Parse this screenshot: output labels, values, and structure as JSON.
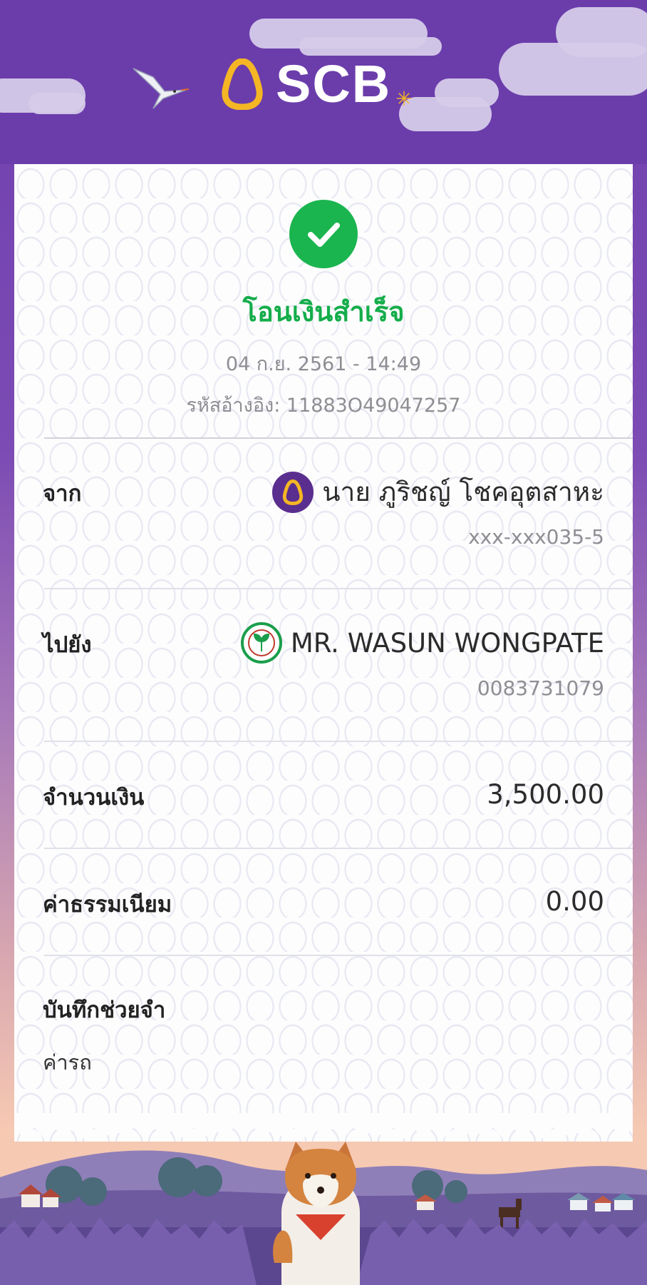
{
  "brand": {
    "name": "SCB",
    "primary_color": "#6b3dab",
    "accent_color": "#f4b624"
  },
  "status": {
    "icon": "check-circle-icon",
    "title": "โอนเงินสำเร็จ",
    "color": "#14ad4a"
  },
  "datetime": "04 ก.ย. 2561 - 14:49",
  "reference": "รหัสอ้างอิง: 11883O49047257",
  "from": {
    "label": "จาก",
    "name": "นาย ภูริชญ์ โชคอุตสาหะ",
    "account": "xxx-xxx035-5",
    "bank_icon": "scb-bank-icon"
  },
  "to": {
    "label": "ไปยัง",
    "name": "MR. WASUN WONGPATE",
    "account": "0083731079",
    "bank_icon": "kbank-bank-icon"
  },
  "amount": {
    "label": "จำนวนเงิน",
    "value": "3,500.00"
  },
  "fee": {
    "label": "ค่าธรรมเนียม",
    "value": "0.00"
  },
  "memo": {
    "label": "บันทึกช่วยจำ",
    "value": "ค่ารถ"
  }
}
